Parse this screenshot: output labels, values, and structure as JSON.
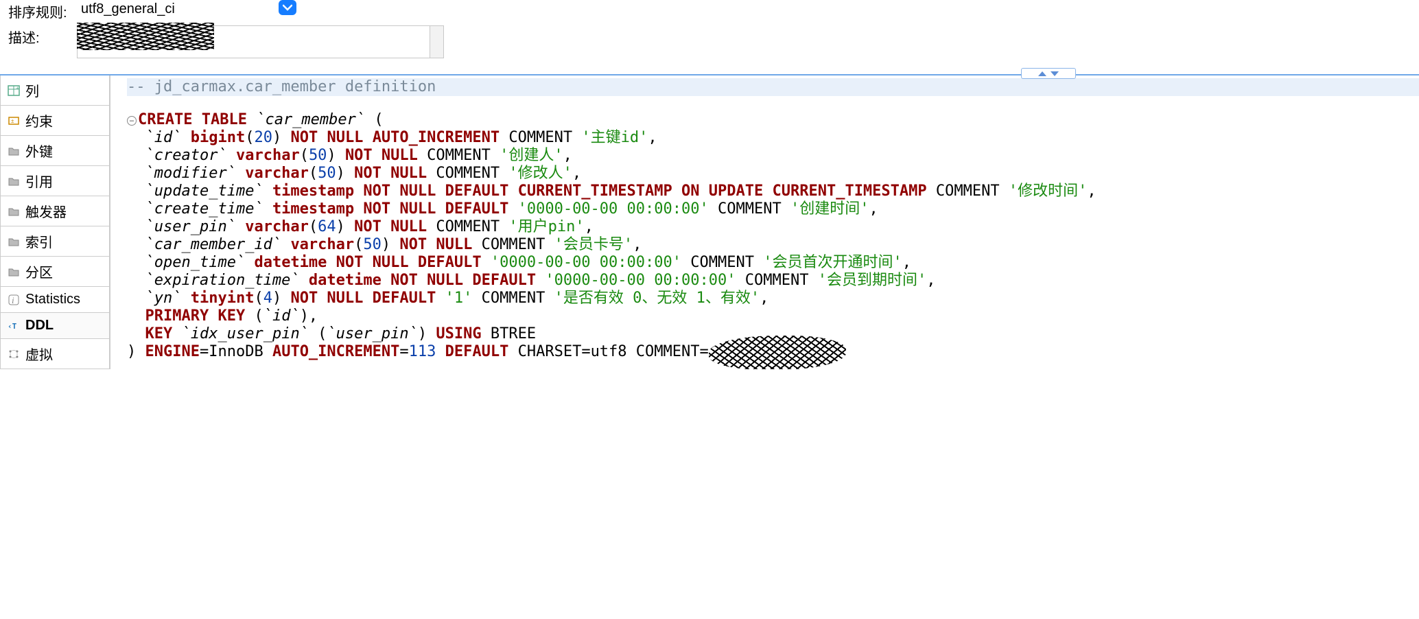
{
  "form": {
    "collation_label": "排序规则:",
    "collation_value": "utf8_general_ci",
    "desc_label": "描述:",
    "desc_value": ""
  },
  "sidebar": {
    "items": [
      {
        "label": "列",
        "icon": "columns"
      },
      {
        "label": "约束",
        "icon": "constraint"
      },
      {
        "label": "外键",
        "icon": "folder"
      },
      {
        "label": "引用",
        "icon": "folder"
      },
      {
        "label": "触发器",
        "icon": "folder"
      },
      {
        "label": "索引",
        "icon": "folder"
      },
      {
        "label": "分区",
        "icon": "folder"
      },
      {
        "label": "Statistics",
        "icon": "info"
      },
      {
        "label": "DDL",
        "icon": "ddl",
        "active": true
      },
      {
        "label": "虚拟",
        "icon": "virtual"
      }
    ]
  },
  "sql": {
    "comment": "-- jd_carmax.car_member definition",
    "create": "CREATE TABLE",
    "table": "`car_member`",
    "cols": [
      {
        "name": "`id`",
        "type": "bigint",
        "len": "20",
        "nn": "NOT NULL",
        "extra": "AUTO_INCREMENT",
        "kw2": "COMMENT",
        "c": "'主键id'"
      },
      {
        "name": "`creator`",
        "type": "varchar",
        "len": "50",
        "nn": "NOT NULL",
        "kw2": "COMMENT",
        "c": "'创建人'"
      },
      {
        "name": "`modifier`",
        "type": "varchar",
        "len": "50",
        "nn": "NOT NULL",
        "kw2": "COMMENT",
        "c": "'修改人'"
      },
      {
        "name": "`update_time`",
        "type": "timestamp",
        "nn": "NOT NULL",
        "def": "DEFAULT",
        "defv": "CURRENT_TIMESTAMP",
        "on": "ON UPDATE",
        "onv": "CURRENT_TIMESTAMP",
        "kw2": "COMMENT",
        "c": "'修改时间'"
      },
      {
        "name": "`create_time`",
        "type": "timestamp",
        "nn": "NOT NULL",
        "def": "DEFAULT",
        "defs": "'0000-00-00 00:00:00'",
        "kw2": "COMMENT",
        "c": "'创建时间'"
      },
      {
        "name": "`user_pin`",
        "type": "varchar",
        "len": "64",
        "nn": "NOT NULL",
        "kw2": "COMMENT",
        "c": "'用户pin'"
      },
      {
        "name": "`car_member_id`",
        "type": "varchar",
        "len": "50",
        "nn": "NOT NULL",
        "kw2": "COMMENT",
        "c": "'会员卡号'"
      },
      {
        "name": "`open_time`",
        "type": "datetime",
        "nn": "NOT NULL",
        "def": "DEFAULT",
        "defs": "'0000-00-00 00:00:00'",
        "kw2": "COMMENT",
        "c": "'会员首次开通时间'"
      },
      {
        "name": "`expiration_time`",
        "type": "datetime",
        "nn": "NOT NULL",
        "def": "DEFAULT",
        "defs": "'0000-00-00 00:00:00'",
        "kw2": "COMMENT",
        "c": "'会员到期时间'"
      },
      {
        "name": "`yn`",
        "type": "tinyint",
        "len": "4",
        "nn": "NOT NULL",
        "def": "DEFAULT",
        "defs": "'1'",
        "kw2": "COMMENT",
        "c": "'是否有效 0、无效 1、有效'"
      }
    ],
    "pk": "PRIMARY KEY",
    "pk_col": "`id`",
    "key": "KEY",
    "key_name": "`idx_user_pin`",
    "key_col": "`user_pin`",
    "using": "USING",
    "btree": "BTREE",
    "tail_engine": "ENGINE",
    "tail_engine_v": "InnoDB",
    "tail_ai": "AUTO_INCREMENT",
    "tail_ai_v": "113",
    "tail_def": "DEFAULT",
    "tail_charset": "CHARSET=utf8",
    "tail_comment": "COMMENT"
  }
}
